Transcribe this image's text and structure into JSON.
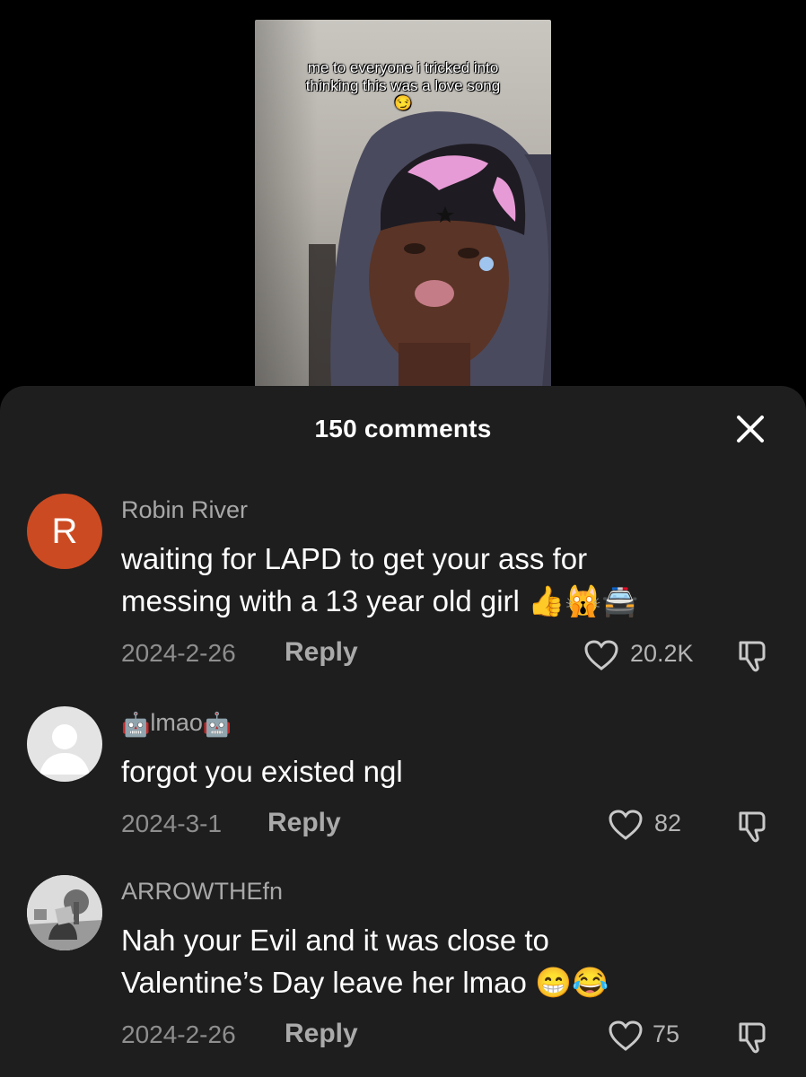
{
  "video": {
    "caption_line1": "me to everyone i tricked into",
    "caption_line2": "thinking this was a love song",
    "caption_emoji": "😏"
  },
  "sheet": {
    "title": "150 comments",
    "close_icon": "close-icon"
  },
  "comments": [
    {
      "avatar_letter": "R",
      "avatar_color": "#cc4a21",
      "username": "Robin River",
      "text_line1": "waiting for LAPD to get your ass for",
      "text_line2": "messing with a 13 year old girl 👍🙀🚔",
      "date": "2024-2-26",
      "reply": "Reply",
      "likes": "20.2K"
    },
    {
      "avatar_letter": "",
      "username_prefix": "🤖",
      "username": "lmao",
      "username_suffix": "🤖",
      "text_line1": "forgot you existed ngl",
      "date": "2024-3-1",
      "reply": "Reply",
      "likes": "82"
    },
    {
      "avatar_letter": "",
      "username": "ARROWTHEfn",
      "text_line1": "Nah your Evil and it was close to",
      "text_line2": "Valentine’s Day leave her lmao 😁😂",
      "date": "2024-2-26",
      "reply": "Reply",
      "likes": "75"
    }
  ],
  "colors": {
    "sheet_bg": "#1e1e1e",
    "secondary_text": "#a8a8a8",
    "avatar_r": "#cc4a21"
  }
}
